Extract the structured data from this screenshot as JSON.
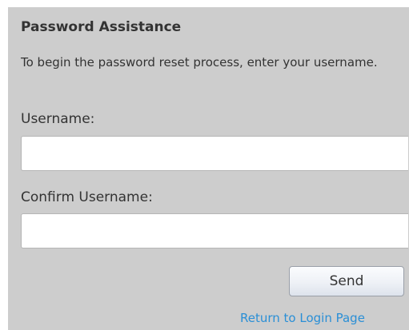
{
  "form": {
    "title": "Password Assistance",
    "description": "To begin the password reset process, enter your username.",
    "username_label": "Username:",
    "username_value": "",
    "confirm_label": "Confirm Username:",
    "confirm_value": "",
    "send_label": "Send",
    "return_link": "Return to Login Page"
  },
  "colors": {
    "panel_background": "#cdcdcd",
    "text": "#333333",
    "link": "#2a8fd6"
  }
}
